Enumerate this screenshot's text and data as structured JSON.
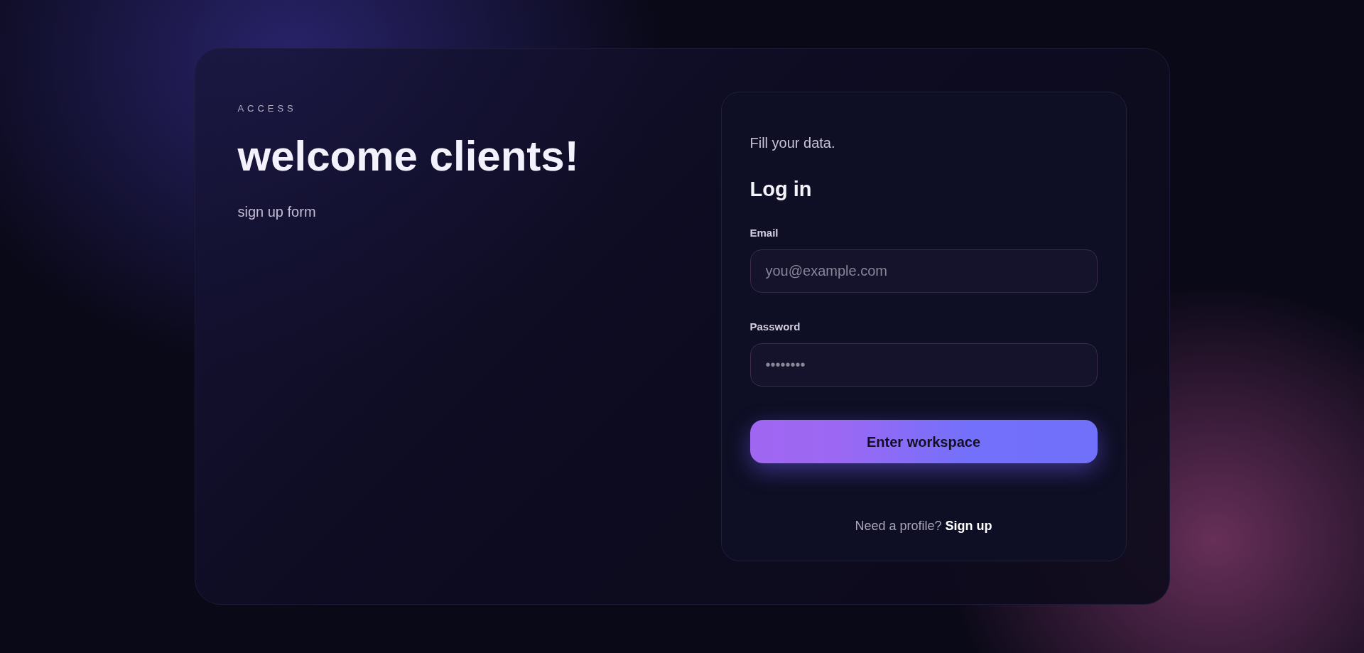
{
  "hero": {
    "eyebrow": "ACCESS",
    "title": "welcome clients!",
    "subtitle": "sign up form"
  },
  "form": {
    "intro": "Fill your data.",
    "title": "Log in",
    "fields": [
      {
        "label": "Email",
        "placeholder": "you@example.com"
      },
      {
        "label": "Password",
        "placeholder": "••••••••"
      }
    ],
    "submit": "Enter workspace",
    "footer": {
      "text": "Need a profile?",
      "link": "Sign up"
    }
  }
}
